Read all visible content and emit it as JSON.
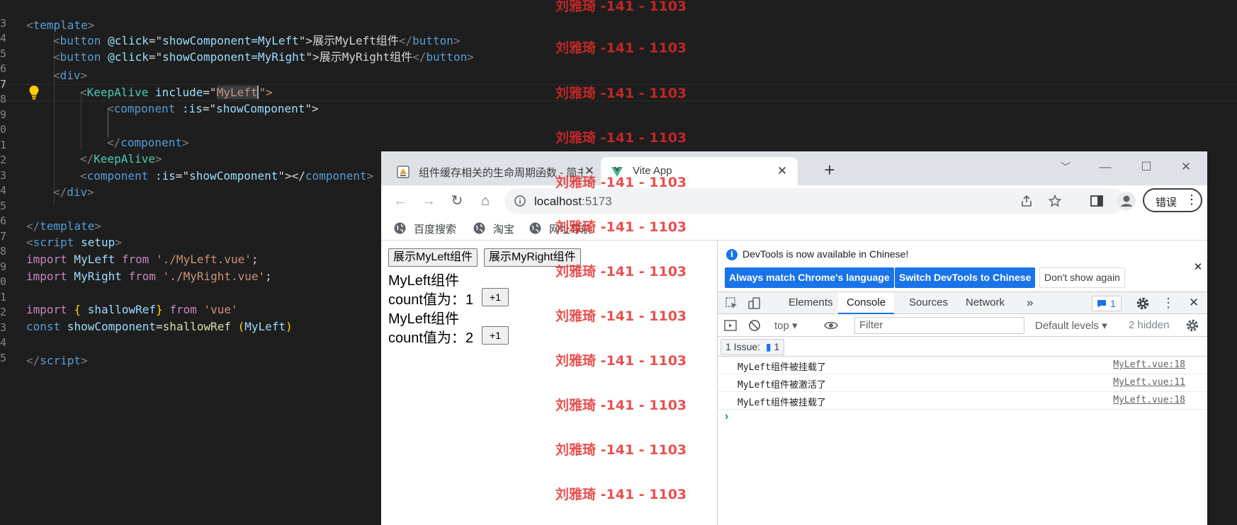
{
  "editor": {
    "gutter_numbers": [
      "3",
      "4",
      "5",
      "6",
      "7",
      "8",
      "9",
      "0",
      "1",
      "2",
      "3",
      "4",
      "5",
      "6",
      "7",
      "8",
      "9",
      "0",
      "1",
      "2",
      "3",
      "4",
      "5"
    ],
    "lines": {
      "l1": {
        "t1": "<",
        "t2": "template",
        "t3": ">"
      },
      "l2": {
        "t1": "<",
        "t2": "button",
        "t3": " ",
        "t4": "@click",
        "t5": "=\"",
        "t6": "showComponent=MyLeft",
        "t7": "\">",
        "t8": "展示MyLeft组件",
        "t9": "</",
        "t10": "button",
        "t11": ">"
      },
      "l3": {
        "t1": "<",
        "t2": "button",
        "t3": " ",
        "t4": "@click",
        "t5": "=\"",
        "t6": "showComponent=MyRight",
        "t7": "\">",
        "t8": "展示MyRight组件",
        "t9": "</",
        "t10": "button",
        "t11": ">"
      },
      "l4": {
        "t1": "<",
        "t2": "div",
        "t3": ">"
      },
      "l5": {
        "t1": "<",
        "t2": "KeepAlive",
        "t3": " ",
        "t4": "include",
        "t5": "=\"",
        "t6": "MyLeft",
        "t7": "\">"
      },
      "l6": {
        "t1": "<",
        "t2": "component",
        "t3": " ",
        "t4": ":is",
        "t5": "=\"",
        "t6": "showComponent",
        "t7": "\">"
      },
      "l7": {
        "t1": "</",
        "t2": "component",
        "t3": ">"
      },
      "l8": {
        "t1": "</",
        "t2": "KeepAlive",
        "t3": ">"
      },
      "l9": {
        "t1": "<",
        "t2": "component",
        "t3": " ",
        "t4": ":is",
        "t5": "=\"",
        "t6": "showComponent",
        "t7": "\"></",
        "t8": "component",
        "t9": ">"
      },
      "l10": {
        "t1": "</",
        "t2": "div",
        "t3": ">"
      },
      "l11": {
        "t1": "</",
        "t2": "template",
        "t3": ">"
      },
      "l12": {
        "t1": "<",
        "t2": "script",
        "t3": " ",
        "t4": "setup",
        "t5": ">"
      },
      "l13": {
        "t1": "import",
        "t2": " MyLeft ",
        "t3": "from",
        "t4": " ",
        "t5": "'./MyLeft.vue'",
        "t6": ";"
      },
      "l14": {
        "t1": "import",
        "t2": " MyRight ",
        "t3": "from",
        "t4": " ",
        "t5": "'./MyRight.vue'",
        "t6": ";"
      },
      "l15": {
        "t1": "import",
        "t2": " ",
        "t3": "{",
        "t4": " shallowRef",
        "t5": "}",
        "t6": " ",
        "t7": "from",
        "t8": " ",
        "t9": "'vue'"
      },
      "l16": {
        "t1": "const",
        "t2": " showComponent",
        "t3": "=",
        "t4": "shallowRef",
        "t5": " ",
        "t6": "(",
        "t7": "MyLeft",
        "t8": ")"
      },
      "l17": {
        "t1": "</",
        "t2": "script",
        "t3": ">"
      }
    }
  },
  "watermark": {
    "text": "刘雅琦 -141 - 1103"
  },
  "browser": {
    "tabs": [
      {
        "title": "组件缓存相关的生命周期函数 - 简书",
        "close": "✕"
      },
      {
        "title": "Vite App",
        "close": "✕"
      }
    ],
    "new_tab": "+",
    "window_controls": {
      "collapse": "﹀",
      "minimize": "—",
      "maximize": "☐",
      "close": "✕"
    },
    "nav": {
      "back": "←",
      "forward": "→",
      "reload": "↻",
      "home": "⌂"
    },
    "url": {
      "host": "localhost",
      "port": ":5173"
    },
    "error_chip_label": "错误",
    "bookmarks": [
      "百度搜索",
      "淘宝",
      "网址导航"
    ]
  },
  "page": {
    "btn_left": "展示MyLeft组件",
    "btn_right": "展示MyRight组件",
    "component1": {
      "title": "MyLeft组件",
      "count_label": "count值为：",
      "count": "1",
      "plus": "+1"
    },
    "component2": {
      "title": "MyLeft组件",
      "count_label": "count值为：",
      "count": "2",
      "plus": "+1"
    }
  },
  "devtools": {
    "info_text": "DevTools is now available in Chinese!",
    "btn_match": "Always match Chrome's language",
    "btn_switch": "Switch DevTools to Chinese",
    "btn_dont_show": "Don't show again",
    "info_close": "✕",
    "tabs": [
      "Elements",
      "Console",
      "Sources",
      "Network"
    ],
    "more_tabs": "»",
    "issues_badge_count": "1",
    "context": "top",
    "filter_placeholder": "Filter",
    "levels": "Default levels ▾",
    "hidden": "2 hidden",
    "issues_label": "1 Issue:",
    "issues_count": "1",
    "close": "✕",
    "menu": "⋮",
    "logs": [
      {
        "message": "MyLeft组件被挂载了",
        "source": "MyLeft.vue:18"
      },
      {
        "message": "MyLeft组件被激活了",
        "source": "MyLeft.vue:11"
      },
      {
        "message": "MyLeft组件被挂载了",
        "source": "MyLeft.vue:18"
      }
    ],
    "prompt": "›"
  },
  "colors": {
    "editor_bg": "#1e1e1e",
    "tag": "#569cd6",
    "component_tag": "#4ec9b0",
    "attribute": "#9cdcfe",
    "string": "#ce9178",
    "keyword": "#c586c0",
    "function": "#dcdcaa",
    "watermark": "#e42a2a",
    "devtools_accent": "#1a73e8"
  },
  "icons": {
    "bulb": "lightbulb-icon",
    "info": "info-icon",
    "globe": "globe-icon",
    "vite": "vite-logo-icon"
  }
}
